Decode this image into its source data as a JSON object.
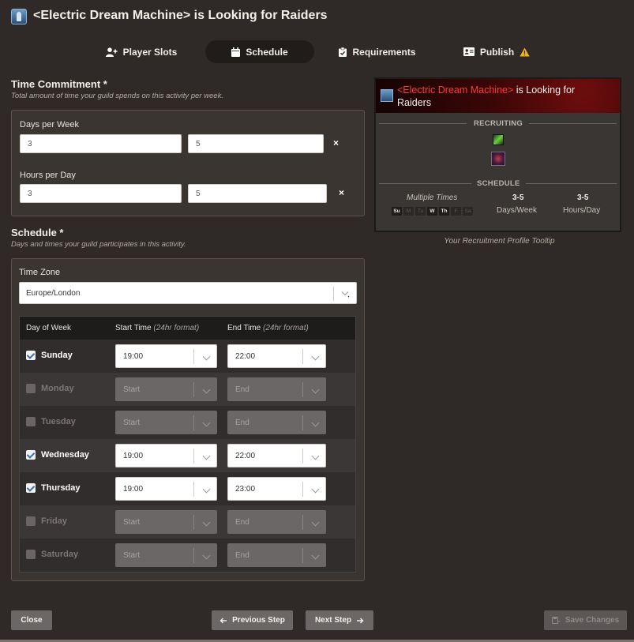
{
  "header": {
    "title": "<Electric Dream Machine> is Looking for Raiders"
  },
  "tabs": [
    {
      "label": "Player Slots",
      "icon": "add-user-icon"
    },
    {
      "label": "Schedule",
      "icon": "calendar-icon",
      "active": true
    },
    {
      "label": "Requirements",
      "icon": "clipboard-check-icon"
    },
    {
      "label": "Publish",
      "icon": "id-card-icon",
      "warning_icon": "warning-icon"
    }
  ],
  "time_commitment": {
    "title": "Time Commitment *",
    "subtitle": "Total amount of time your guild spends on this activity per week.",
    "days_label": "Days per Week",
    "days_min": "3",
    "days_max": "5",
    "hours_label": "Hours per Day",
    "hours_min": "3",
    "hours_max": "5",
    "clear_glyph": "×"
  },
  "schedule": {
    "title": "Schedule *",
    "subtitle": "Days and times your guild participates in this activity.",
    "timezone_label": "Time Zone",
    "timezone_value": "Europe/London",
    "columns": {
      "day": "Day of Week",
      "start": "Start Time",
      "end": "End Time",
      "format_hint": "(24hr format)"
    },
    "days": [
      {
        "name": "Sunday",
        "checked": true,
        "start": "19:00",
        "end": "22:00"
      },
      {
        "name": "Monday",
        "checked": false,
        "start": "Start",
        "end": "End"
      },
      {
        "name": "Tuesday",
        "checked": false,
        "start": "Start",
        "end": "End"
      },
      {
        "name": "Wednesday",
        "checked": true,
        "start": "19:00",
        "end": "22:00"
      },
      {
        "name": "Thursday",
        "checked": true,
        "start": "19:00",
        "end": "23:00"
      },
      {
        "name": "Friday",
        "checked": false,
        "start": "Start",
        "end": "End"
      },
      {
        "name": "Saturday",
        "checked": false,
        "start": "Start",
        "end": "End"
      }
    ]
  },
  "tooltip": {
    "title_red": "<Electric Dream Machine>",
    "title_rest": " is Looking for Raiders",
    "recruiting_label": "RECRUITING",
    "schedule_label": "SCHEDULE",
    "times_label": "Multiple Times",
    "day_chips": [
      {
        "label": "Su",
        "active": true
      },
      {
        "label": "M",
        "active": false
      },
      {
        "label": "Tu",
        "active": false
      },
      {
        "label": "W",
        "active": true
      },
      {
        "label": "Th",
        "active": true
      },
      {
        "label": "F",
        "active": false
      },
      {
        "label": "Sa",
        "active": false
      }
    ],
    "days_value": "3-5",
    "days_caption": "Days/Week",
    "hours_value": "3-5",
    "hours_caption": "Hours/Day",
    "caption": "Your Recruitment Profile Tooltip"
  },
  "footer": {
    "close": "Close",
    "previous": "Previous Step",
    "next": "Next Step",
    "save": "Save Changes"
  },
  "colors": {
    "background": "#2f2a27",
    "accent_red": "#ff3a3a",
    "checkbox_check": "#3b6fb6",
    "warning": "#f2b21b"
  }
}
